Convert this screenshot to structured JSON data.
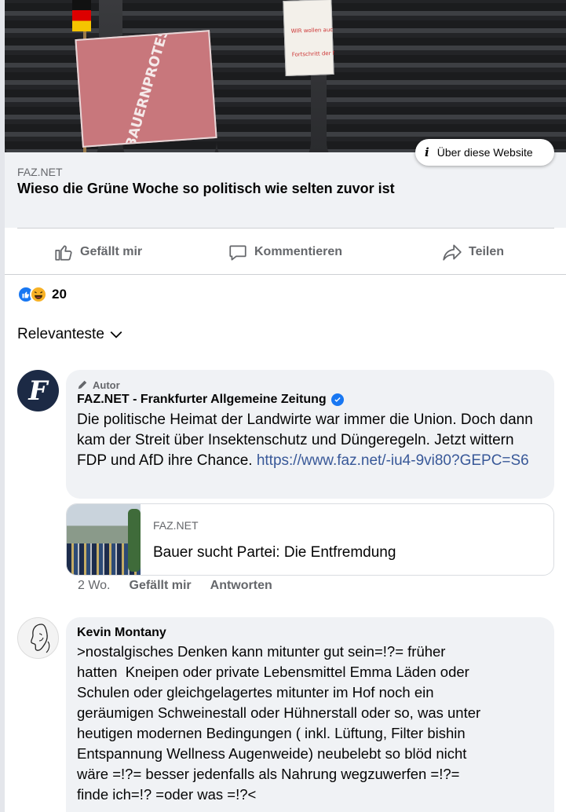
{
  "link_preview": {
    "source": "FAZ.NET",
    "headline": "Wieso die Grüne Woche so politisch wie selten zuvor ist",
    "about_button": "Über diese Website",
    "image": {
      "sign_text": "#BAUERNPROTEST",
      "sign2_lines": [
        "WIR wollen auch",
        "Fortschritt der Natur"
      ]
    }
  },
  "actions": [
    {
      "label": "Gefällt mir",
      "icon": "thumbs-up-icon"
    },
    {
      "label": "Kommentieren",
      "icon": "comment-icon"
    },
    {
      "label": "Teilen",
      "icon": "share-icon"
    }
  ],
  "reactions": {
    "count": "20",
    "types": [
      "like",
      "haha"
    ]
  },
  "sort": {
    "label": "Relevanteste",
    "icon": "chevron-down-icon"
  },
  "comments": [
    {
      "tag": "Autor",
      "author": "FAZ.NET - Frankfurter Allgemeine Zeitung",
      "verified": true,
      "text": "Die politische Heimat der Landwirte war immer die Union. Doch dann kam der Streit über Insektenschutz und Düngeregeln. Jetzt wittern FDP und AfD ihre Chance. ",
      "link": "https://www.faz.net/-iu4-9vi80?GEPC=S6",
      "card": {
        "source": "FAZ.NET",
        "title": "Bauer sucht Partei: Die Entfremdung"
      },
      "time": "2 Wo.",
      "like": "Gefällt mir",
      "reply": "Antworten"
    },
    {
      "author": "Kevin Montany",
      "text": ">nostalgisches Denken kann mitunter gut sein=!?= früher\nhatten  Kneipen oder private Lebensmittel Emma Läden oder\nSchulen oder gleichgelagertes mitunter im Hof noch ein\ngeräumigen Schweinestall oder Hühnerstall oder so, was unter\nheutigen modernen Bedingungen ( inkl. Lüftung, Filter bishin\nEntspannung Wellness Augenweide) neubelebt so blöd nicht\nwäre =!?= besser jedenfalls als Nahrung wegzuwerfen =!?=\nfinde ich=!? =oder was =!?<"
    }
  ],
  "colors": {
    "accent": "#1877f2",
    "link": "#385898",
    "muted": "#65676b",
    "bubble": "#f0f2f5"
  }
}
